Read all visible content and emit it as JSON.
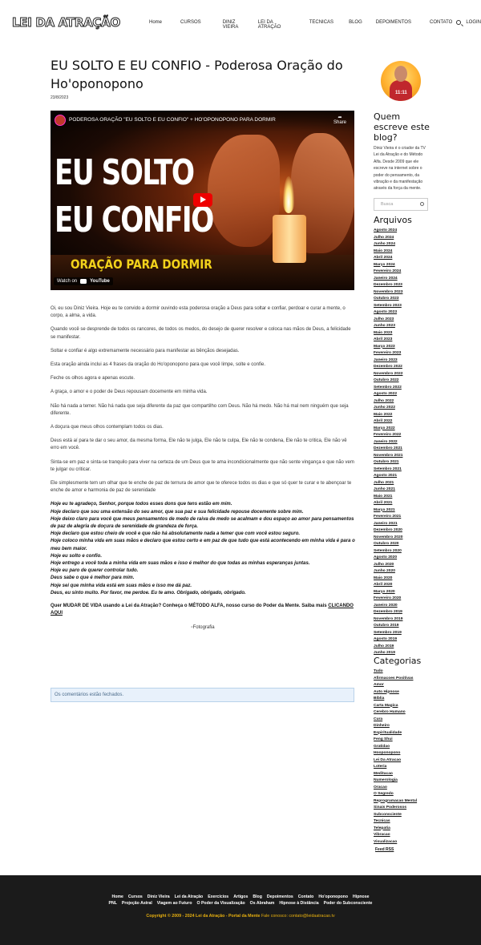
{
  "header": {
    "logo": "LEI DA ATRAÇÃO",
    "nav": [
      "Home",
      "CURSOS",
      "DINIZ VIEIRA",
      "LEI DA ATRAÇÃO",
      "TECNICAS",
      "BLOG",
      "DEPOIMENTOS",
      "CONTATO",
      "LOGIN"
    ]
  },
  "post": {
    "title": "EU SOLTO E EU CONFIO - Poderosa Oração do Ho'oponopono",
    "date": "23/8/2023",
    "video": {
      "title": "PODEROSA ORAÇÃO \"EU SOLTO E EU CONFIO\" + HO'OPONOPONO PARA DORMIR",
      "share": "Share",
      "big1": "EU SOLTO",
      "big2": "EU CONFIO",
      "sub": "ORAÇÃO PARA DORMIR",
      "watch_on": "Watch on",
      "youtube": "YouTube"
    },
    "paragraphs": [
      "Oi, eu sou Diniz Vieira. Hoje eu te convido a dormir ouvindo esta poderosa oração a Deus para soltar e confiar, perdoar e curar a mente, o corpo, a alma, a vida.",
      "Quando você se desprende de todos os rancores, de todos os medos, do desejo de querer resolver e coloca nas mãos de Deus, a felicidade se manifestar.",
      "Soltar e confiar é algo extremamente necessário para manifestar as bênçãos desejadas.",
      "Esta oração ainda inclui as 4 frases da oração do Ho'oponopono para que você limpe, solte e confie.",
      "Feche os olhos agora e apenas escute.",
      "A graça, o amor e o poder de Deus repousam docemente em minha vida.",
      "Não há nada a temer. Não há nada que seja diferente da paz que compartilho com Deus. Não há medo. Não há mal nem ninguém que seja diferente.",
      "A doçura que meus olhos contemplam todos os dias.",
      "Deus está aí para te dar o seu amor, da mesma forma, Ele não te julga, Ele não te culpa, Ele não te condena, Ele não te critica, Ele não vê erro em você.",
      "Sinta-se em paz e sinta-se tranquilo para viver na certeza de um Deus que te ama incondicionalmente que não sente vingança e que não vem te julgar ou criticar.",
      "Ele simplesmente tem um olhar que te enche de paz de ternura de amor que te oferece todos os dias e que só quer te curar e te abençoar te enche de amor e harmonia de paz de serenidade"
    ],
    "prayer": [
      "Hoje eu te agradeço, Senhor, porque todos esses dons que tens estão em mim.",
      "Hoje declaro que sou uma extensão do seu amor, que sua paz e sua felicidade repouse docemente sobre mim.",
      "Hoje deixo claro para você que meus pensamentos de medo de raiva de medo se acalmam e dou espaço ao amor para pensamentos de paz de alegria de doçura de serenidade de grandeza de força.",
      "Hoje declaro que estou cheio de você e que não há absolutamente nada a temer que com você estou seguro.",
      "Hoje coloco minha vida em suas mãos e declaro que estou certo e em paz de que tudo que está acontecendo em minha vida é para o meu bem maior.",
      "Hoje eu solto e confio.",
      "Hoje entrego a você toda a minha vida em suas mãos e isso é melhor do que todas as minhas esperanças juntas.",
      "Hoje eu paro de querer controlar tudo.",
      "Deus sabe o que é melhor para mim.",
      "Hoje sei que minha vida está em suas mãos e isso me dá paz.",
      "Deus, eu sinto muito. Por favor, me perdoe. Eu te amo. Obrigado, obrigado, obrigado."
    ],
    "cta_text": "Quer MUDAR DE VIDA usando a Lei da Atração? Conheça o MÉTODO ALFA, nosso curso do Poder da Mente. Saiba mais ",
    "cta_link": "CLICANDO AQUI",
    "photo_alt": "Fotografia",
    "comments_closed": "Os comentários estão fechados."
  },
  "sidebar": {
    "who_title": "Quem escreve este blog?",
    "who_text": "Diniz Vieira é o criador da TV Lei da Atração e do Método Alfa. Desde 2009 que ele escreve na internet sobre o poder do pensamento, da vibração e da manifestação através da força da mente.",
    "search_placeholder": "Busca",
    "archives_title": "Arquivos",
    "archives": [
      "Agosto 2024",
      "Julho 2024",
      "Junho 2024",
      "Maio 2024",
      "Abril 2024",
      "Março 2024",
      "Fevereiro 2024",
      "Janeiro 2024",
      "Dezembro 2023",
      "Novembro 2023",
      "Outubro 2023",
      "Setembro 2023",
      "Agosto 2023",
      "Julho 2023",
      "Junho 2023",
      "Maio 2023",
      "Abril 2023",
      "Março 2023",
      "Fevereiro 2023",
      "Janeiro 2023",
      "Dezembro 2022",
      "Novembro 2022",
      "Outubro 2022",
      "Setembro 2022",
      "Agosto 2022",
      "Julho 2022",
      "Junho 2022",
      "Maio 2022",
      "Abril 2022",
      "Março 2022",
      "Fevereiro 2022",
      "Janeiro 2022",
      "Dezembro 2021",
      "Novembro 2021",
      "Outubro 2021",
      "Setembro 2021",
      "Agosto 2021",
      "Julho 2021",
      "Junho 2021",
      "Maio 2021",
      "Abril 2021",
      "Março 2021",
      "Fevereiro 2021",
      "Janeiro 2021",
      "Dezembro 2020",
      "Novembro 2020",
      "Outubro 2020",
      "Setembro 2020",
      "Agosto 2020",
      "Julho 2020",
      "Junho 2020",
      "Maio 2020",
      "Abril 2020",
      "Março 2020",
      "Fevereiro 2020",
      "Janeiro 2020",
      "Dezembro 2019",
      "Novembro 2019",
      "Outubro 2019",
      "Setembro 2019",
      "Agosto 2019",
      "Julho 2019",
      "Junho 2019"
    ],
    "categories_title": "Categorias",
    "categories": [
      "Tudo",
      "Afirmacoes Positivas",
      "Amor",
      "Auto Hipnose",
      "Bíblia",
      "Carta Magica",
      "Cerebro Humano",
      "Cura",
      "Dinheiro",
      "Espiritualidade",
      "Feng Shui",
      "Gratidao",
      "Hooponopono",
      "Lei Da Atracao",
      "Loteria",
      "Meditacao",
      "Numerologia",
      "Oracao",
      "O Segredo",
      "Reprogramacao Mental",
      "Sinais Poderosos",
      "Subconsciente",
      "Tecnicas",
      "Telepatia",
      "Vibracao",
      "Visualizacao"
    ],
    "feed": "Feed RSS"
  },
  "footer": {
    "row1": [
      "Home",
      "Cursos",
      "Diniz Vieira",
      "Lei da Atração",
      "Exercícios",
      "Artigos",
      "Blog",
      "Depoimentos",
      "Contato",
      "Ho'oponopono",
      "Hipnose"
    ],
    "row2": [
      "PNL",
      "Projeção Astral",
      "Viagem ao Futuro",
      "O Poder da Visualização",
      "Os Abraham",
      "Hipnose à Distância",
      "Poder do Subconsciente"
    ],
    "copyright": "Copyright © 2009 - 2024 Lei da Atração - Portal da Mente",
    "contact": " Fale conosco: contato@leidaatracao.tv"
  }
}
